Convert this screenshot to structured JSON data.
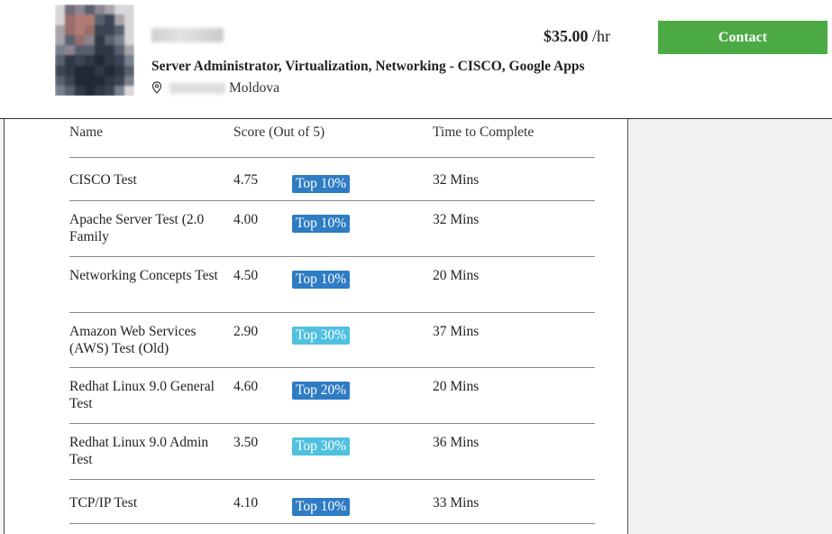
{
  "profile": {
    "name": "",
    "rate_amount": "$35.00",
    "rate_unit": "/hr",
    "title": "Server Administrator, Virtualization, Networking - CISCO, Google Apps",
    "location_country": "Moldova",
    "contact_label": "Contact"
  },
  "colors": {
    "contact": "#4caa45",
    "badge_dark": "#2e7cc4",
    "badge_light": "#4fc0e0"
  },
  "table": {
    "headers": {
      "name": "Name",
      "score": "Score (Out of 5)",
      "time": "Time to Complete"
    },
    "rows": [
      {
        "name": "CISCO Test",
        "score": "4.75",
        "badge": "Top 10%",
        "badge_tone": "dark",
        "time": "32 Mins"
      },
      {
        "name": "Apache Server Test (2.0 Family",
        "score": "4.00",
        "badge": "Top 10%",
        "badge_tone": "dark",
        "time": "32 Mins"
      },
      {
        "name": "Networking Concepts Test",
        "score": "4.50",
        "badge": "Top 10%",
        "badge_tone": "dark",
        "time": "20 Mins"
      },
      {
        "name": "Amazon Web Services (AWS) Test (Old)",
        "score": "2.90",
        "badge": "Top 30%",
        "badge_tone": "light",
        "time": "37 Mins"
      },
      {
        "name": "Redhat Linux 9.0 General Test",
        "score": "4.60",
        "badge": "Top 20%",
        "badge_tone": "dark",
        "time": "20 Mins"
      },
      {
        "name": "Redhat Linux 9.0 Admin Test",
        "score": "3.50",
        "badge": "Top 30%",
        "badge_tone": "light",
        "time": "36 Mins"
      },
      {
        "name": "TCP/IP Test",
        "score": "4.10",
        "badge": "Top 10%",
        "badge_tone": "dark",
        "time": "33 Mins"
      }
    ]
  }
}
